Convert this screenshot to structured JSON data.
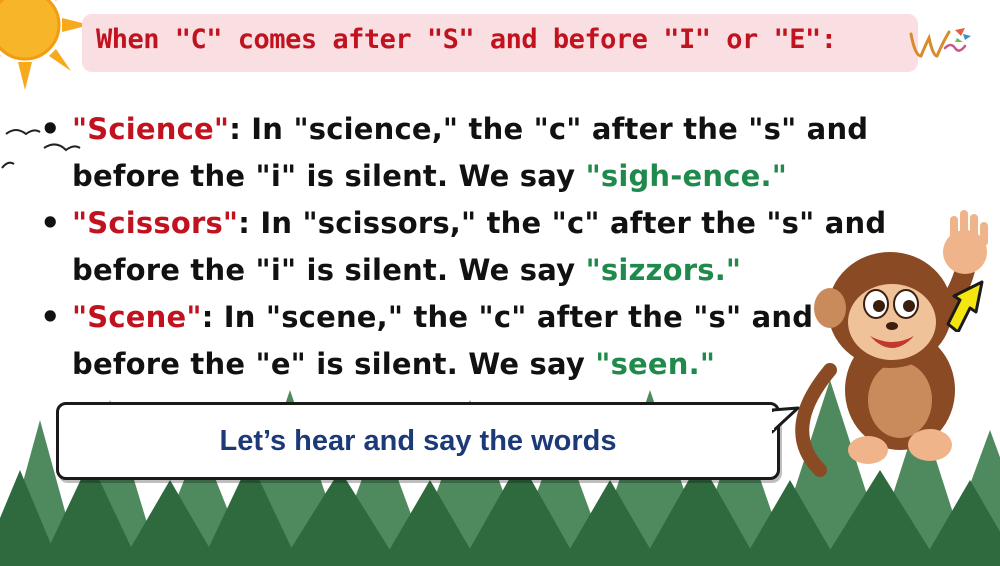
{
  "title": "When \"C\" comes after \"S\" and before \"I\" or \"E\":",
  "bullets": [
    {
      "term": "\"Science\"",
      "text": ": In \"science,\" the \"c\" after the \"s\" and before the \"i\" is silent. We say ",
      "pronunciation": "\"sigh-ence.\""
    },
    {
      "term": "\"Scissors\"",
      "text": ": In \"scissors,\" the \"c\" after the \"s\" and before the \"i\" is silent. We say ",
      "pronunciation": "\"sizzors.\""
    },
    {
      "term": "\"Scene\"",
      "text": ": In \"scene,\" the \"c\" after the \"s\" and before the \"e\" is silent. We say ",
      "pronunciation": "\"seen.\""
    }
  ],
  "speech_bubble": "Let’s hear and say the words",
  "colors": {
    "title": "#c1121f",
    "title_bar_bg": "#f9dfe1",
    "term": "#c1121f",
    "pronunciation": "#1f8a4c",
    "bubble_text": "#1d3a78",
    "forest": "#3f7a4f",
    "sun": "#f7a81b",
    "monkey": "#8a4a24"
  },
  "icons": {
    "sun": "sun-icon",
    "logo": "logo-icon",
    "birds": "birds-icon",
    "monkey": "monkey-illustration",
    "forest": "pine-forest",
    "arrow": "arrow-icon"
  }
}
